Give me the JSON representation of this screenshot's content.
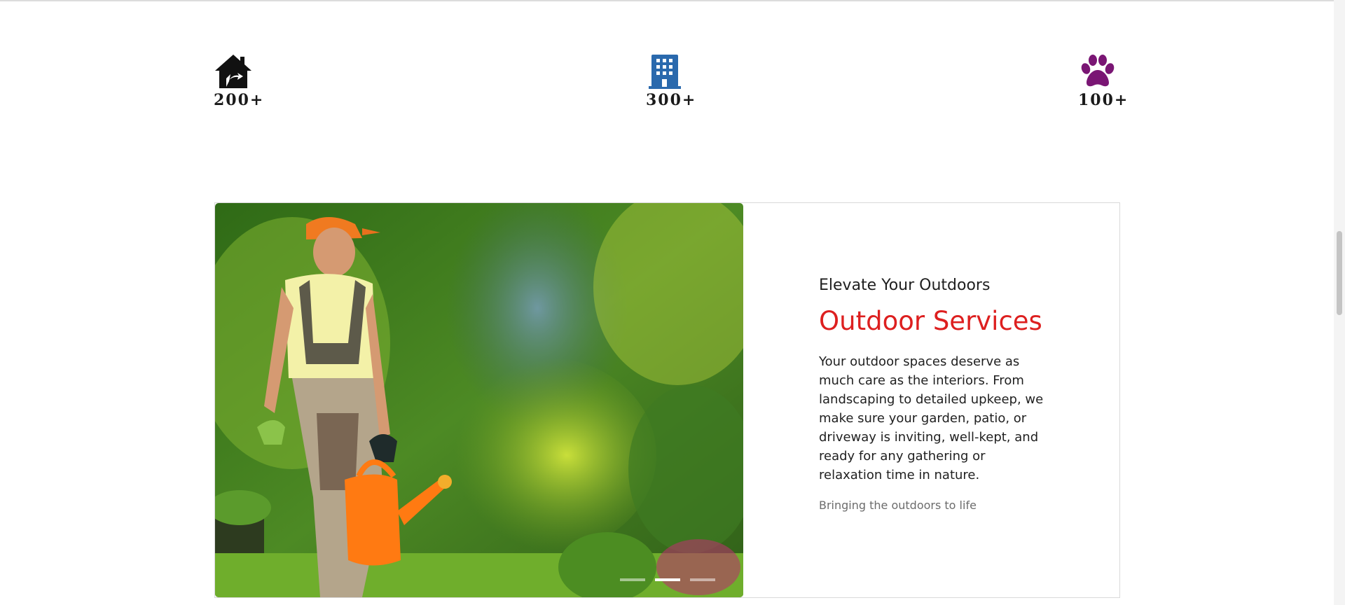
{
  "stats": [
    {
      "icon": "house-icon",
      "count": "200+",
      "color": "#111111"
    },
    {
      "icon": "building-icon",
      "count": "300+",
      "color": "#2a69ad"
    },
    {
      "icon": "paw-icon",
      "count": "100+",
      "color": "#7a1674"
    }
  ],
  "card": {
    "eyebrow": "Elevate Your Outdoors",
    "title": "Outdoor Services",
    "description": "Your outdoor spaces deserve as much care as the interiors. From landscaping to detailed upkeep, we make sure your garden, patio, or driveway is inviting, well-kept, and ready for any gathering or relaxation time in nature.",
    "tagline": "Bringing the outdoors to life",
    "title_color": "#dd1f1f"
  },
  "carousel": {
    "indicators": [
      {
        "active": false
      },
      {
        "active": true
      },
      {
        "active": false
      }
    ]
  }
}
